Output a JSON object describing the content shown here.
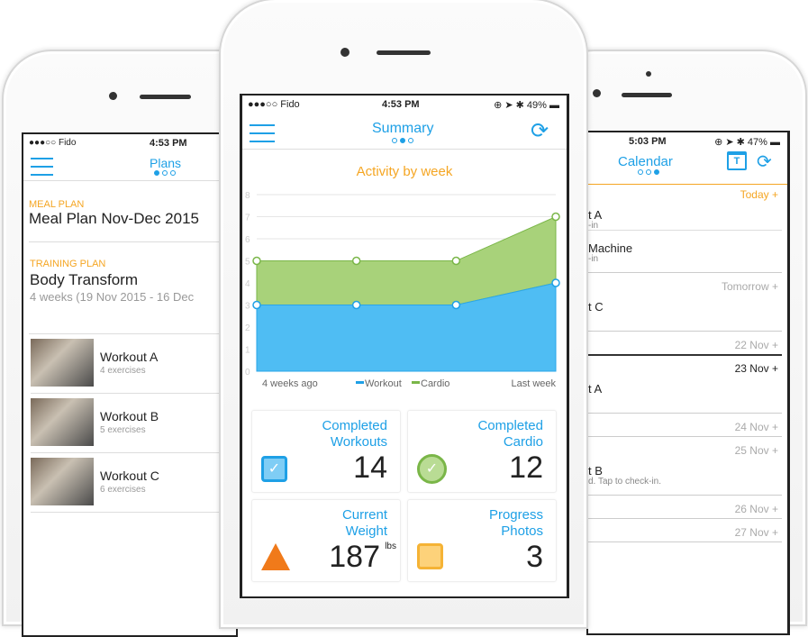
{
  "colors": {
    "accent": "#1ea0e6",
    "orange": "#f5a623",
    "workout": "#4fbdf3",
    "cardio": "#a8d27a"
  },
  "left": {
    "status": {
      "carrier": "●●●○○ Fido",
      "time": "4:53 PM"
    },
    "title": "Plans",
    "meal": {
      "label": "MEAL PLAN",
      "title": "Meal Plan Nov-Dec 2015"
    },
    "training": {
      "label": "TRAINING PLAN",
      "title": "Body Transform",
      "dates": "4 weeks (19 Nov 2015 - 16 Dec"
    },
    "workouts": [
      {
        "name": "Workout A",
        "sub": "4 exercises"
      },
      {
        "name": "Workout B",
        "sub": "5 exercises"
      },
      {
        "name": "Workout C",
        "sub": "6 exercises"
      }
    ]
  },
  "center": {
    "status": {
      "carrier": "●●●○○ Fido",
      "time": "4:53 PM",
      "battery": "49%"
    },
    "title": "Summary",
    "cards": [
      {
        "label1": "Completed",
        "label2": "Workouts",
        "value": "14",
        "icon": "checkbox-icon"
      },
      {
        "label1": "Completed",
        "label2": "Cardio",
        "value": "12",
        "icon": "check-circle-icon"
      },
      {
        "label1": "Current",
        "label2": "Weight",
        "value": "187",
        "unit": "lbs",
        "icon": "scale-icon"
      },
      {
        "label1": "Progress",
        "label2": "Photos",
        "value": "3",
        "icon": "photo-icon"
      }
    ]
  },
  "chart_data": {
    "type": "area",
    "stacked": true,
    "title": "Activity by week",
    "x": [
      "4 weeks ago",
      "",
      "",
      "Last week"
    ],
    "xtick_labels": [
      "4 weeks ago",
      "Last week"
    ],
    "ylim": [
      0,
      8
    ],
    "yticks": [
      "0",
      "1",
      "2",
      "3",
      "4",
      "5",
      "6",
      "7",
      "8"
    ],
    "grid": true,
    "legend": "bottom-center",
    "series": [
      {
        "name": "Workout",
        "values": [
          3,
          3,
          3,
          4
        ]
      },
      {
        "name": "Cardio",
        "values": [
          2,
          2,
          2,
          3
        ]
      }
    ]
  },
  "right": {
    "status": {
      "time": "5:03 PM",
      "battery": "47%"
    },
    "title": "Calendar",
    "today_icon_label": "T",
    "days": [
      {
        "date": "Today +",
        "items": [
          {
            "t": "t A",
            "s": "-in"
          },
          {
            "t": "Machine",
            "s": "-in"
          }
        ]
      },
      {
        "date": "Tomorrow +",
        "items": [
          {
            "t": "t C",
            "s": ""
          }
        ]
      },
      {
        "date": "22 Nov +",
        "items": []
      },
      {
        "date": "23 Nov +",
        "items": [
          {
            "t": "t A",
            "s": ""
          }
        ]
      },
      {
        "date": "24 Nov +",
        "items": []
      },
      {
        "date": "25 Nov +",
        "items": [
          {
            "t": "t B",
            "s": "d. Tap to check-in."
          }
        ]
      },
      {
        "date": "26 Nov +",
        "items": []
      },
      {
        "date": "27 Nov +",
        "items": []
      }
    ]
  }
}
